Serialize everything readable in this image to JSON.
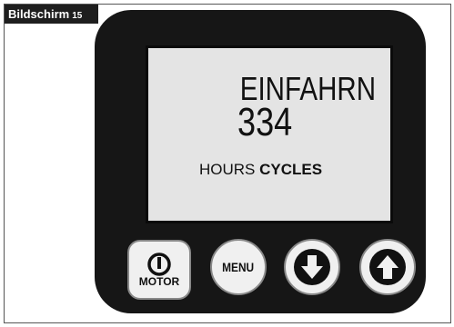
{
  "header": {
    "screen_label": "Bildschirm",
    "screen_number": "15"
  },
  "display": {
    "mode_text": "EINFAHRN",
    "count_value": "334",
    "units_hours": "HOURS",
    "units_cycles": "CYCLES"
  },
  "buttons": {
    "motor_label": "MOTOR",
    "menu_label": "MENU"
  },
  "icons": {
    "motor": "power-icon",
    "down": "arrow-down-icon",
    "up": "arrow-up-icon"
  },
  "colors": {
    "device_body": "#161616",
    "lcd_background": "#e4e4e4",
    "button_face": "#f0f0f0"
  }
}
